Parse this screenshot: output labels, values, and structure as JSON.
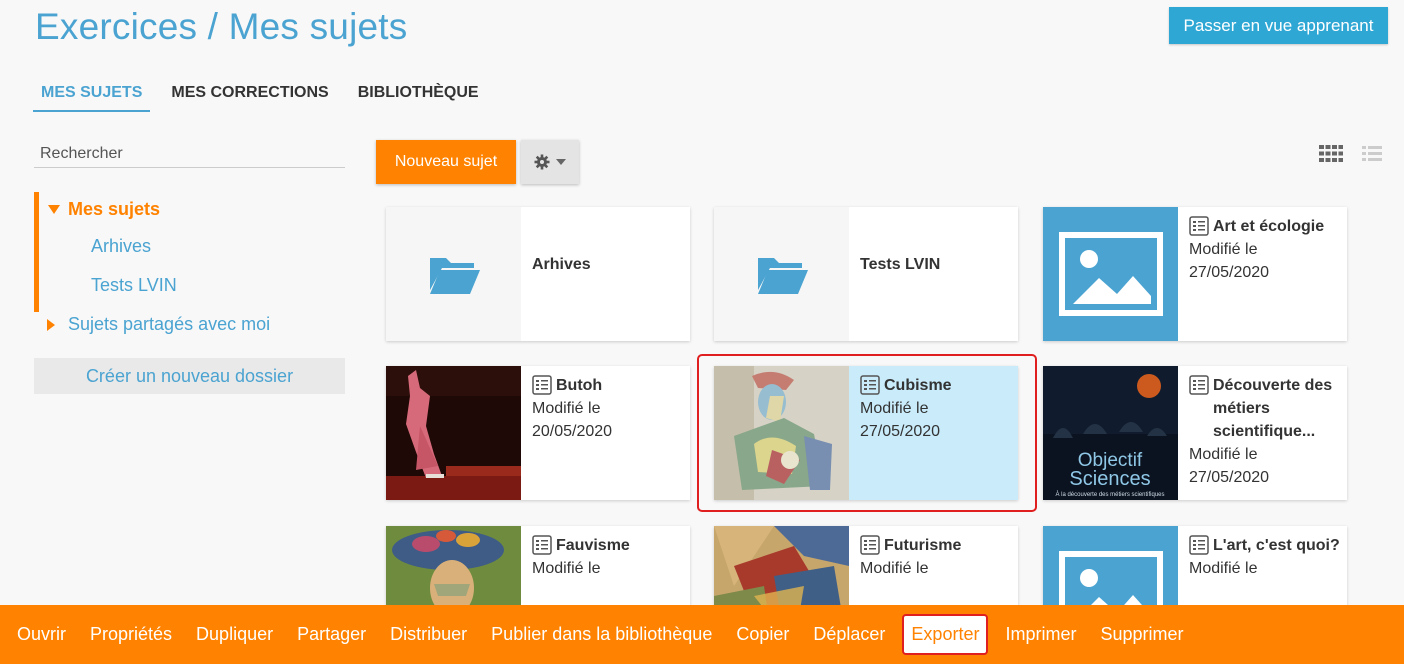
{
  "header": {
    "title": "Exercices / Mes sujets",
    "learner_view_label": "Passer en vue apprenant"
  },
  "tabs": [
    {
      "label": "MES SUJETS",
      "active": true
    },
    {
      "label": "MES CORRECTIONS",
      "active": false
    },
    {
      "label": "BIBLIOTHÈQUE",
      "active": false
    }
  ],
  "sidebar": {
    "search_placeholder": "Rechercher",
    "tree": {
      "root_label": "Mes sujets",
      "children": [
        "Arhives",
        "Tests LVIN"
      ]
    },
    "shared_label": "Sujets partagés avec moi",
    "new_folder_label": "Créer un nouveau dossier"
  },
  "toolbar": {
    "new_subject_label": "Nouveau sujet",
    "settings_icon": "gear-icon",
    "view_icons": [
      "grid-view-icon",
      "list-view-icon"
    ]
  },
  "cards": [
    {
      "type": "folder",
      "title": "Arhives"
    },
    {
      "type": "folder",
      "title": "Tests LVIN"
    },
    {
      "type": "exercise",
      "title": "Art et écologie",
      "modified_label": "Modifié le",
      "date": "27/05/2020",
      "thumb": "placeholder-image"
    },
    {
      "type": "exercise",
      "title": "Butoh",
      "modified_label": "Modifié le",
      "date": "20/05/2020",
      "thumb": "photo-dancer"
    },
    {
      "type": "exercise",
      "title": "Cubisme",
      "modified_label": "Modifié le",
      "date": "27/05/2020",
      "thumb": "cubist-painting",
      "selected": true
    },
    {
      "type": "exercise",
      "title": "Découverte des métiers scientifique...",
      "modified_label": "Modifié le",
      "date": "27/05/2020",
      "thumb": "objectif-sciences-poster"
    },
    {
      "type": "exercise",
      "title": "Fauvisme",
      "modified_label": "Modifié le",
      "date": "",
      "thumb": "fauvist-painting"
    },
    {
      "type": "exercise",
      "title": "Futurisme",
      "modified_label": "Modifié le",
      "date": "",
      "thumb": "futurist-painting"
    },
    {
      "type": "exercise",
      "title": "L'art, c'est quoi?",
      "modified_label": "Modifié le",
      "date": "",
      "thumb": "placeholder-image"
    }
  ],
  "thumbnail_text": {
    "poster_title_1": "Objectif",
    "poster_title_2": "Sciences",
    "poster_subtitle": "À la découverte des métiers scientifiques"
  },
  "actions": [
    {
      "label": "Ouvrir"
    },
    {
      "label": "Propriétés"
    },
    {
      "label": "Dupliquer"
    },
    {
      "label": "Partager"
    },
    {
      "label": "Distribuer"
    },
    {
      "label": "Publier dans la bibliothèque"
    },
    {
      "label": "Copier"
    },
    {
      "label": "Déplacer"
    },
    {
      "label": "Exporter",
      "highlighted": true
    },
    {
      "label": "Imprimer"
    },
    {
      "label": "Supprimer"
    }
  ],
  "colors": {
    "accent_blue": "#4aa3d1",
    "accent_orange": "#ff8200",
    "selection_bg": "#c9ebfa",
    "highlight_outline": "#e02020"
  }
}
